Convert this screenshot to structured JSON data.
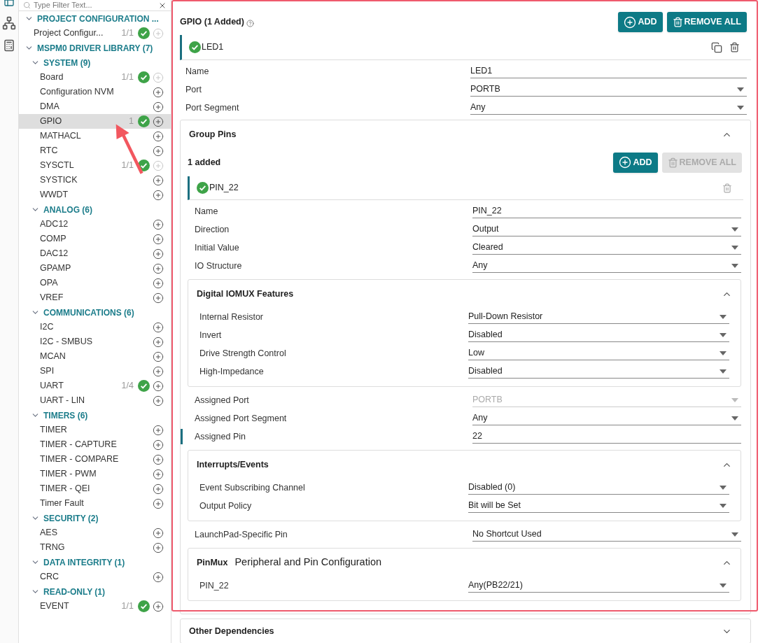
{
  "sidebar": {
    "filter": {
      "placeholder": "Type Filter Text..."
    },
    "tree": [
      {
        "kind": "group",
        "label": "PROJECT CONFIGURATION ...",
        "expanded": true,
        "children": [
          {
            "kind": "module",
            "label": "Project Configur...",
            "count": "1/1",
            "configured": true,
            "add_disabled": true,
            "selected": false
          }
        ]
      },
      {
        "kind": "group",
        "label": "MSPM0 DRIVER LIBRARY (7)",
        "expanded": true,
        "children": [
          {
            "kind": "group",
            "label": "SYSTEM (9)",
            "expanded": true,
            "children": [
              {
                "kind": "module",
                "label": "Board",
                "count": "1/1",
                "configured": true,
                "add_disabled": true,
                "selected": false
              },
              {
                "kind": "module",
                "label": "Configuration NVM",
                "configured": false,
                "add_disabled": false,
                "selected": false
              },
              {
                "kind": "module",
                "label": "DMA",
                "configured": false,
                "add_disabled": false,
                "selected": false
              },
              {
                "kind": "module",
                "label": "GPIO",
                "count": "1",
                "configured": true,
                "add_disabled": false,
                "selected": true
              },
              {
                "kind": "module",
                "label": "MATHACL",
                "configured": false,
                "add_disabled": false,
                "selected": false
              },
              {
                "kind": "module",
                "label": "RTC",
                "configured": false,
                "add_disabled": false,
                "selected": false
              },
              {
                "kind": "module",
                "label": "SYSCTL",
                "count": "1/1",
                "configured": true,
                "add_disabled": true,
                "selected": false
              },
              {
                "kind": "module",
                "label": "SYSTICK",
                "configured": false,
                "add_disabled": false,
                "selected": false
              },
              {
                "kind": "module",
                "label": "WWDT",
                "configured": false,
                "add_disabled": false,
                "selected": false
              }
            ]
          },
          {
            "kind": "group",
            "label": "ANALOG (6)",
            "expanded": true,
            "children": [
              {
                "kind": "module",
                "label": "ADC12",
                "configured": false,
                "add_disabled": false,
                "selected": false
              },
              {
                "kind": "module",
                "label": "COMP",
                "configured": false,
                "add_disabled": false,
                "selected": false
              },
              {
                "kind": "module",
                "label": "DAC12",
                "configured": false,
                "add_disabled": false,
                "selected": false
              },
              {
                "kind": "module",
                "label": "GPAMP",
                "configured": false,
                "add_disabled": false,
                "selected": false
              },
              {
                "kind": "module",
                "label": "OPA",
                "configured": false,
                "add_disabled": false,
                "selected": false
              },
              {
                "kind": "module",
                "label": "VREF",
                "configured": false,
                "add_disabled": false,
                "selected": false
              }
            ]
          },
          {
            "kind": "group",
            "label": "COMMUNICATIONS (6)",
            "expanded": true,
            "children": [
              {
                "kind": "module",
                "label": "I2C",
                "configured": false,
                "add_disabled": false,
                "selected": false
              },
              {
                "kind": "module",
                "label": "I2C - SMBUS",
                "configured": false,
                "add_disabled": false,
                "selected": false
              },
              {
                "kind": "module",
                "label": "MCAN",
                "configured": false,
                "add_disabled": false,
                "selected": false
              },
              {
                "kind": "module",
                "label": "SPI",
                "configured": false,
                "add_disabled": false,
                "selected": false
              },
              {
                "kind": "module",
                "label": "UART",
                "count": "1/4",
                "configured": true,
                "add_disabled": false,
                "selected": false
              },
              {
                "kind": "module",
                "label": "UART - LIN",
                "configured": false,
                "add_disabled": false,
                "selected": false
              }
            ]
          },
          {
            "kind": "group",
            "label": "TIMERS (6)",
            "expanded": true,
            "children": [
              {
                "kind": "module",
                "label": "TIMER",
                "configured": false,
                "add_disabled": false,
                "selected": false
              },
              {
                "kind": "module",
                "label": "TIMER - CAPTURE",
                "configured": false,
                "add_disabled": false,
                "selected": false
              },
              {
                "kind": "module",
                "label": "TIMER - COMPARE",
                "configured": false,
                "add_disabled": false,
                "selected": false
              },
              {
                "kind": "module",
                "label": "TIMER - PWM",
                "configured": false,
                "add_disabled": false,
                "selected": false
              },
              {
                "kind": "module",
                "label": "TIMER - QEI",
                "configured": false,
                "add_disabled": false,
                "selected": false
              },
              {
                "kind": "module",
                "label": "Timer Fault",
                "configured": false,
                "add_disabled": false,
                "selected": false
              }
            ]
          },
          {
            "kind": "group",
            "label": "SECURITY (2)",
            "expanded": true,
            "children": [
              {
                "kind": "module",
                "label": "AES",
                "configured": false,
                "add_disabled": false,
                "selected": false
              },
              {
                "kind": "module",
                "label": "TRNG",
                "configured": false,
                "add_disabled": false,
                "selected": false
              }
            ]
          },
          {
            "kind": "group",
            "label": "DATA INTEGRITY (1)",
            "expanded": true,
            "children": [
              {
                "kind": "module",
                "label": "CRC",
                "configured": false,
                "add_disabled": false,
                "selected": false
              }
            ]
          },
          {
            "kind": "group",
            "label": "READ-ONLY (1)",
            "expanded": true,
            "children": [
              {
                "kind": "module",
                "label": "EVENT",
                "count": "1/1",
                "configured": true,
                "add_disabled": false,
                "selected": false
              }
            ]
          }
        ]
      }
    ]
  },
  "module": {
    "title": "GPIO (1 Added)",
    "add_button": "ADD",
    "remove_all_button": "REMOVE ALL",
    "instance": {
      "name": "LED1",
      "configured": true,
      "fields": [
        {
          "kind": "text",
          "label": "Name",
          "value": "LED1",
          "disabled": false,
          "flagged": false
        },
        {
          "kind": "select",
          "label": "Port",
          "value": "PORTB",
          "disabled": false,
          "flagged": false
        },
        {
          "kind": "select",
          "label": "Port Segment",
          "value": "Any",
          "disabled": false,
          "flagged": false
        }
      ],
      "group_pins": {
        "title": "Group Pins",
        "expanded": true,
        "count": "1 added",
        "add_button": "ADD",
        "remove_all_button": "REMOVE ALL",
        "remove_all_disabled": true,
        "pin": {
          "name": "PIN_22",
          "configured": true,
          "items": [
            {
              "kind": "text",
              "label": "Name",
              "value": "PIN_22",
              "disabled": false,
              "flagged": false
            },
            {
              "kind": "select",
              "label": "Direction",
              "value": "Output",
              "disabled": false,
              "flagged": false
            },
            {
              "kind": "select",
              "label": "Initial Value",
              "value": "Cleared",
              "disabled": false,
              "flagged": false
            },
            {
              "kind": "select",
              "label": "IO Structure",
              "value": "Any",
              "disabled": false,
              "flagged": false
            },
            {
              "kind": "section",
              "title": "Digital IOMUX Features",
              "expanded": true,
              "fields": [
                {
                  "kind": "select",
                  "label": "Internal Resistor",
                  "value": "Pull-Down Resistor",
                  "disabled": false,
                  "flagged": false
                },
                {
                  "kind": "select",
                  "label": "Invert",
                  "value": "Disabled",
                  "disabled": false,
                  "flagged": false
                },
                {
                  "kind": "select",
                  "label": "Drive Strength Control",
                  "value": "Low",
                  "disabled": false,
                  "flagged": false
                },
                {
                  "kind": "select",
                  "label": "High-Impedance",
                  "value": "Disabled",
                  "disabled": false,
                  "flagged": false
                }
              ]
            },
            {
              "kind": "select",
              "label": "Assigned Port",
              "value": "PORTB",
              "disabled": true,
              "flagged": false
            },
            {
              "kind": "select",
              "label": "Assigned Port Segment",
              "value": "Any",
              "disabled": false,
              "flagged": false
            },
            {
              "kind": "text",
              "label": "Assigned Pin",
              "value": "22",
              "disabled": false,
              "flagged": true
            },
            {
              "kind": "section",
              "title": "Interrupts/Events",
              "expanded": true,
              "fields": [
                {
                  "kind": "select",
                  "label": "Event Subscribing Channel",
                  "value": "Disabled (0)",
                  "disabled": false,
                  "flagged": false
                },
                {
                  "kind": "select",
                  "label": "Output Policy",
                  "value": "Bit will be Set",
                  "disabled": false,
                  "flagged": false
                }
              ]
            },
            {
              "kind": "select",
              "label": "LaunchPad-Specific Pin",
              "value": "No Shortcut Used",
              "disabled": false,
              "flagged": false
            },
            {
              "kind": "section",
              "title": "PinMux",
              "subtitle": "Peripheral and Pin Configuration",
              "expanded": true,
              "fields": [
                {
                  "kind": "select",
                  "label": "PIN_22",
                  "value": "Any(PB22/21)",
                  "disabled": false,
                  "flagged": false
                }
              ]
            }
          ]
        }
      }
    },
    "other_dependencies": {
      "title": "Other Dependencies",
      "expanded": false
    }
  }
}
